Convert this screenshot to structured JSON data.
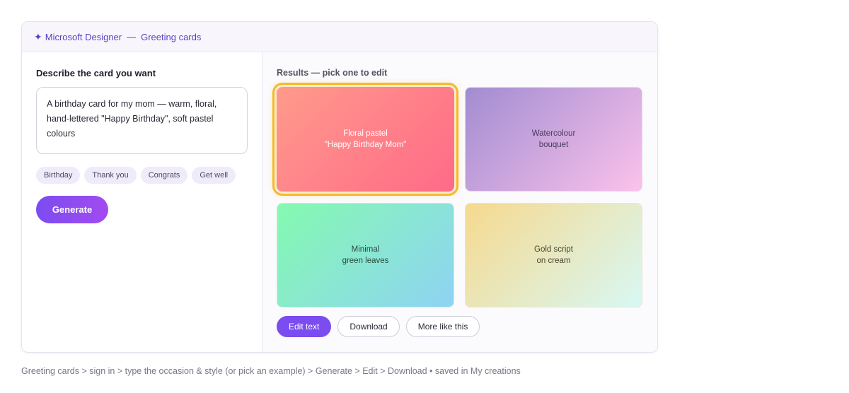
{
  "window": {
    "app_name": "Microsoft Designer",
    "separator": "—",
    "section": "Greeting cards",
    "spark_icon": "✦"
  },
  "left": {
    "heading": "Describe the card you want",
    "prompt_value": "A birthday card for my mom — warm, floral, hand-lettered \"Happy Birthday\", soft pastel colours",
    "chips": [
      "Birthday",
      "Thank you",
      "Congrats",
      "Get well"
    ],
    "generate_label": "Generate"
  },
  "results": {
    "heading": "Results — pick one to edit",
    "cards": [
      {
        "label": "Floral pastel\n\"Happy Birthday Mom\"",
        "selected": true
      },
      {
        "label": "Watercolour\nbouquet",
        "selected": false
      },
      {
        "label": "Minimal\ngreen leaves",
        "selected": false
      },
      {
        "label": "Gold script\non cream",
        "selected": false
      }
    ],
    "actions": {
      "edit_text": "Edit text",
      "download": "Download",
      "more_like_this": "More like this"
    }
  },
  "footer": {
    "text": "Greeting cards > sign in > type the occasion & style (or pick an example) > Generate > Edit > Download  •  saved in My creations"
  },
  "colors": {
    "accent": "#7b4cf0",
    "selection": "#f7b928"
  }
}
